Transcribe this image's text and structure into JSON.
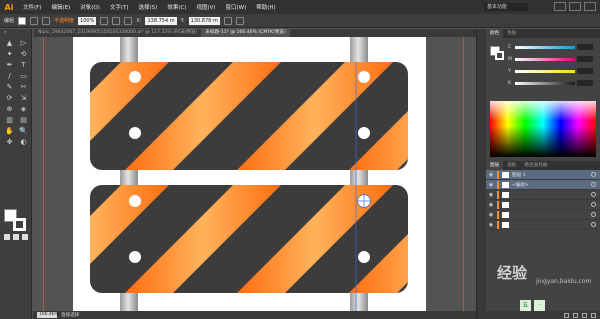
{
  "app": {
    "logo": "Ai"
  },
  "menu": [
    "文件(F)",
    "编辑(E)",
    "对象(O)",
    "文字(T)",
    "选择(S)",
    "效果(C)",
    "视图(V)",
    "窗口(W)",
    "帮助(H)"
  ],
  "workspace_switcher": "基本功能",
  "control_bar": {
    "selection_label": "编组",
    "no_selection_label": "不透明度",
    "opacity_value": "100%",
    "x_label": "X:",
    "x_value": "138.754 m",
    "y_label": "Y:",
    "y_value": "130.878 m"
  },
  "tabs": [
    {
      "label": "Nipic_29842067_20190905150104334000.ai* @ 117.32% (RGB/预览)",
      "active": false
    },
    {
      "label": "未标题-11* @ 166.46% (CMYK/预览)",
      "active": true
    }
  ],
  "toolbox": {
    "header": "»",
    "tools": [
      "▲",
      "▷",
      "✦",
      "⟲",
      "✒",
      "T",
      "/",
      "▭",
      "✎",
      "✂",
      "⟳",
      "⇲",
      "⊕",
      "◈",
      "▥",
      "▤",
      "✋",
      "🔍",
      "✥",
      "◐"
    ]
  },
  "status": {
    "zoom": "166.46%",
    "tool": "直接选择"
  },
  "panels": {
    "color_tabs": [
      "颜色",
      "色板"
    ],
    "channels": [
      {
        "name": "C",
        "color": "#00a0e0"
      },
      {
        "name": "M",
        "color": "#e0007a"
      },
      {
        "name": "Y",
        "color": "#f2e600"
      },
      {
        "name": "K",
        "color": "#1a1a1a"
      }
    ],
    "layers_tabs": [
      "图层",
      "画板",
      "路径查找器"
    ],
    "layers": [
      {
        "name": "图层 1",
        "selected": true
      },
      {
        "name": "<编组>",
        "selected": true
      },
      {
        "name": "",
        "selected": false
      },
      {
        "name": "",
        "selected": false
      },
      {
        "name": "",
        "selected": false
      },
      {
        "name": "",
        "selected": false
      }
    ]
  },
  "watermark": {
    "main": "经验",
    "sub": "jingyan.baidu.com"
  },
  "ime": [
    "五",
    "·"
  ],
  "colors": {
    "accent": "#ff8a2a",
    "stripe_orange": "#ff7a1a",
    "stripe_dark": "#3c3c3c"
  }
}
